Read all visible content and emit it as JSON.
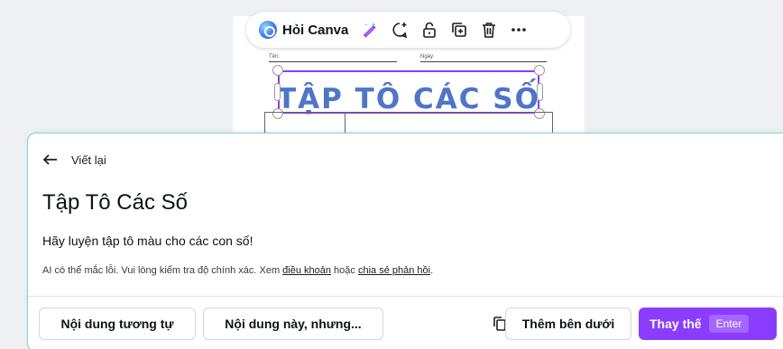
{
  "canvas": {
    "name_label": "Tên:",
    "date_label": "Ngày:",
    "worksheet_title": "TẬP TÔ CÁC SỐ"
  },
  "toolbar": {
    "ai_label": "Hỏi Canva",
    "icons": [
      "magic-edit-icon",
      "comment-add-icon",
      "unlock-icon",
      "duplicate-icon",
      "delete-icon",
      "more-icon"
    ]
  },
  "panel": {
    "back_label": "Viết lại",
    "title": "Tập Tô Các Số",
    "body": "Hãy luyện tập tô màu cho các con số!",
    "disclaimer_prefix": "AI có thể mắc lỗi. Vui lòng kiểm tra độ chính xác. Xem ",
    "terms_link": "điều khoản",
    "disclaimer_mid": " hoặc ",
    "feedback_link": "chia sẻ phản hồi",
    "disclaimer_suffix": "."
  },
  "actions": {
    "similar_label": "Nội dung tương tự",
    "but_label": "Nội dung này, nhưng...",
    "add_below_label": "Thêm bên dưới",
    "replace_label": "Thay thế",
    "replace_shortcut": "Enter"
  },
  "colors": {
    "accent": "#8b3dff",
    "worksheet_title": "#4f74c8",
    "panel_border": "#7fd1d8"
  }
}
